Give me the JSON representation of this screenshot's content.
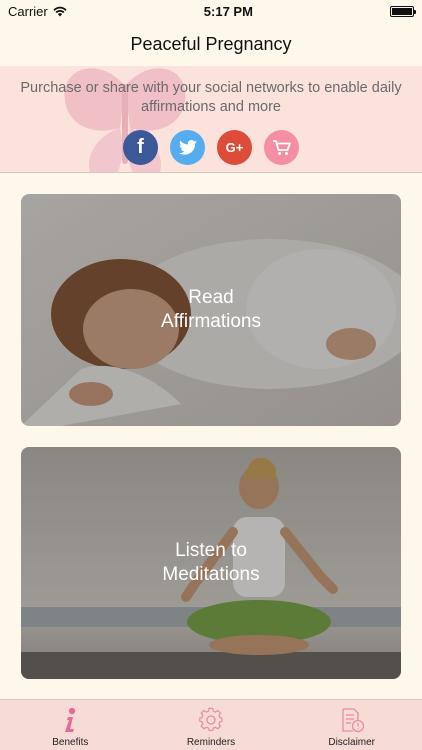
{
  "status_bar": {
    "carrier": "Carrier",
    "time": "5:17 PM",
    "battery_level": 1.0
  },
  "nav": {
    "title": "Peaceful Pregnancy"
  },
  "promo": {
    "text": "Purchase or share with your social networks to enable daily affirmations and more",
    "social": [
      {
        "icon": "facebook-icon",
        "glyph": "f",
        "color": "#3b5998"
      },
      {
        "icon": "twitter-icon",
        "glyph": "",
        "color": "#55acee"
      },
      {
        "icon": "google-plus-icon",
        "glyph": "G+",
        "color": "#dd4b39"
      },
      {
        "icon": "cart-icon",
        "glyph": "",
        "color": "#f48fa3"
      }
    ]
  },
  "cards": [
    {
      "line1": "Read",
      "line2": "Affirmations"
    },
    {
      "line1": "Listen to",
      "line2": "Meditations"
    }
  ],
  "tabs": [
    {
      "label": "Benefits",
      "icon": "info-icon",
      "active": true
    },
    {
      "label": "Reminders",
      "icon": "gear-icon",
      "active": false
    },
    {
      "label": "Disclaimer",
      "icon": "document-icon",
      "active": false
    }
  ],
  "colors": {
    "background": "#fdf8ea",
    "banner": "#fbe3dc",
    "tab_bar": "#f6dcd4",
    "accent_pink": "#e86a9a"
  }
}
